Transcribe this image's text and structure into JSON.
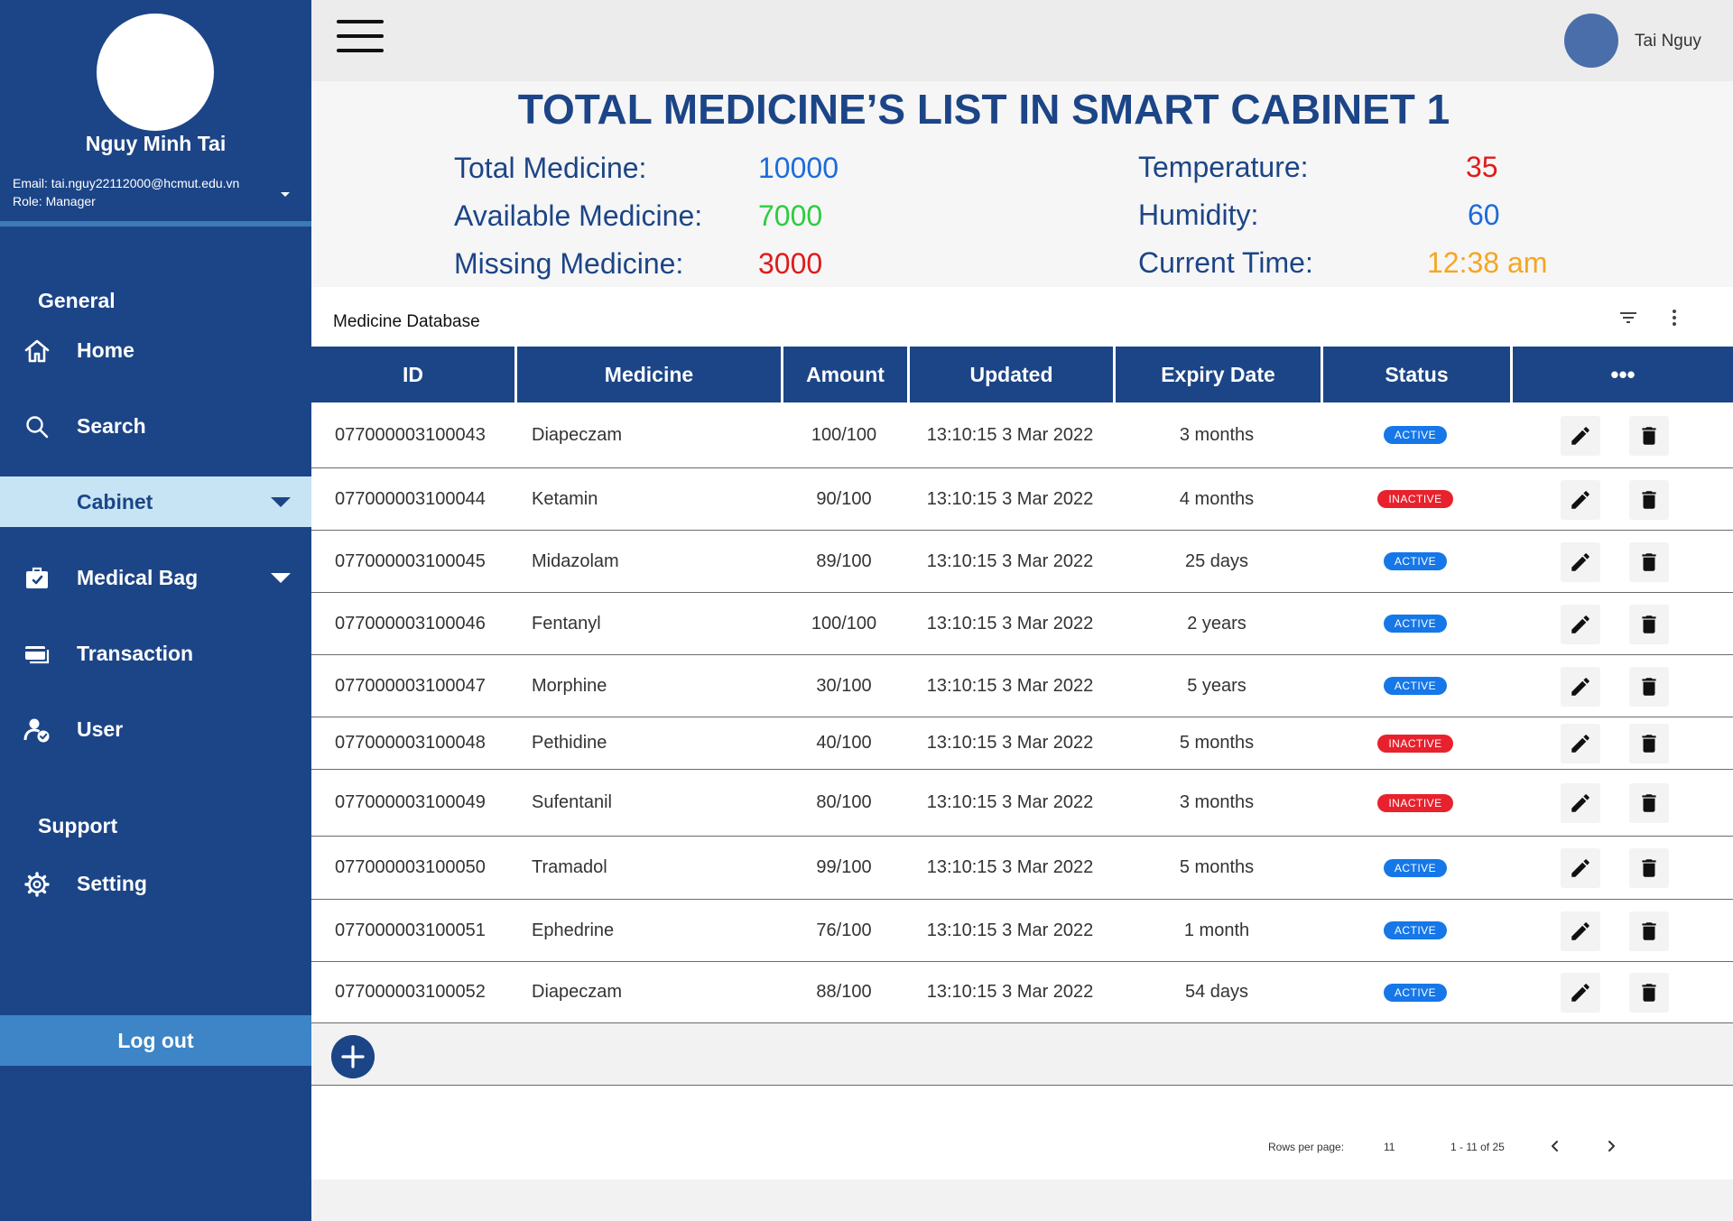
{
  "sidebar": {
    "user_name": "Nguy Minh Tai",
    "email": "Email: tai.nguy22112000@hcmut.edu.vn",
    "role": "Role: Manager",
    "section_general": "General",
    "section_support": "Support",
    "items": [
      {
        "label": "Home",
        "icon": "home-icon"
      },
      {
        "label": "Search",
        "icon": "search-icon"
      },
      {
        "label": "Cabinet",
        "icon": "",
        "active": true
      },
      {
        "label": "Medical Bag",
        "icon": "medical-bag-icon"
      },
      {
        "label": "Transaction",
        "icon": "card-icon"
      },
      {
        "label": "User",
        "icon": "user-check-icon"
      },
      {
        "label": "Setting",
        "icon": "gear-icon"
      }
    ],
    "logout_label": "Log out",
    "colors": {
      "background": "#1c4587",
      "active_bg": "#c7e4f4",
      "logout_bg": "#3d85c6"
    }
  },
  "topbar": {
    "user_name": "Tai Nguy"
  },
  "summary": {
    "title": "TOTAL MEDICINE’S LIST IN SMART CABINET 1",
    "total_label": "Total Medicine:",
    "total_value": "10000",
    "available_label": "Available Medicine:",
    "available_value": "7000",
    "missing_label": "Missing Medicine:",
    "missing_value": "3000",
    "temperature_label": "Temperature:",
    "temperature_value": "35",
    "humidity_label": "Humidity:",
    "humidity_value": "60",
    "time_label": "Current Time:",
    "time_value": "12:38 am",
    "colors": {
      "blue": "#1c6bd9",
      "green": "#2ecc40",
      "red": "#e01b1b",
      "orange": "#f5a623"
    }
  },
  "table": {
    "title": "Medicine Database",
    "columns": [
      "ID",
      "Medicine",
      "Amount",
      "Updated",
      "Expiry Date",
      "Status",
      "•••"
    ],
    "rows": [
      {
        "id": "077000003100043",
        "medicine": "Diapeczam",
        "amount": "100/100",
        "updated": "13:10:15 3 Mar 2022",
        "expiry": "3 months",
        "status": "ACTIVE"
      },
      {
        "id": "077000003100044",
        "medicine": "Ketamin",
        "amount": "90/100",
        "updated": "13:10:15 3 Mar 2022",
        "expiry": "4 months",
        "status": "INACTIVE"
      },
      {
        "id": "077000003100045",
        "medicine": "Midazolam",
        "amount": "89/100",
        "updated": "13:10:15 3 Mar 2022",
        "expiry": "25 days",
        "status": "ACTIVE"
      },
      {
        "id": "077000003100046",
        "medicine": "Fentanyl",
        "amount": "100/100",
        "updated": "13:10:15 3 Mar 2022",
        "expiry": "2 years",
        "status": "ACTIVE"
      },
      {
        "id": "077000003100047",
        "medicine": "Morphine",
        "amount": "30/100",
        "updated": "13:10:15 3 Mar 2022",
        "expiry": "5 years",
        "status": "ACTIVE"
      },
      {
        "id": "077000003100048",
        "medicine": "Pethidine",
        "amount": "40/100",
        "updated": "13:10:15 3 Mar 2022",
        "expiry": "5 months",
        "status": "INACTIVE"
      },
      {
        "id": "077000003100049",
        "medicine": "Sufentanil",
        "amount": "80/100",
        "updated": "13:10:15 3 Mar 2022",
        "expiry": "3 months",
        "status": "INACTIVE"
      },
      {
        "id": "077000003100050",
        "medicine": "Tramadol",
        "amount": "99/100",
        "updated": "13:10:15 3 Mar 2022",
        "expiry": "5 months",
        "status": "ACTIVE"
      },
      {
        "id": "077000003100051",
        "medicine": "Ephedrine",
        "amount": "76/100",
        "updated": "13:10:15 3 Mar 2022",
        "expiry": "1 month",
        "status": "ACTIVE"
      },
      {
        "id": "077000003100052",
        "medicine": "Diapeczam",
        "amount": "88/100",
        "updated": "13:10:15 3 Mar 2022",
        "expiry": "54 days",
        "status": "ACTIVE"
      }
    ],
    "status_colors": {
      "ACTIVE": "#1677e8",
      "INACTIVE": "#e8222d"
    }
  },
  "pagination": {
    "rows_per_page_label": "Rows per page:",
    "rows_per_page_value": "11",
    "range": "1 - 11 of 25"
  }
}
